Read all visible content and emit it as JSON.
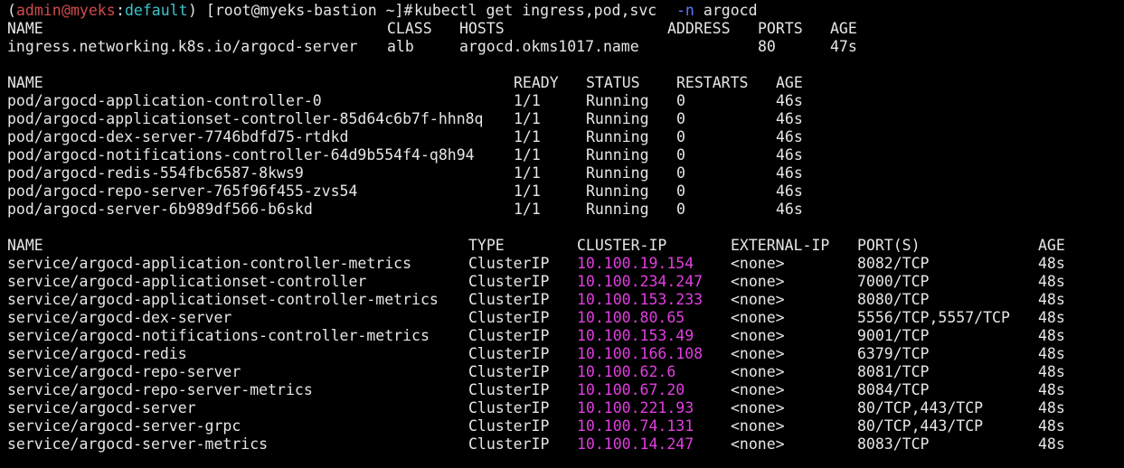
{
  "prompt": {
    "open_paren": "(",
    "user": "admin",
    "at": "@",
    "cluster": "myeks",
    "colon": ":",
    "namespace": "default",
    "close_paren": ")",
    "shell": " [root@myeks-bastion ~]# ",
    "command": "kubectl get ingress,pod,svc ",
    "flag": "-n",
    "arg": " argocd"
  },
  "ingress": {
    "headers": [
      "NAME",
      "CLASS",
      "HOSTS",
      "ADDRESS",
      "PORTS",
      "AGE"
    ],
    "rows": [
      [
        "ingress.networking.k8s.io/argocd-server",
        "alb",
        "argocd.okms1017.name",
        "",
        "80",
        "47s"
      ]
    ]
  },
  "pods": {
    "headers": [
      "NAME",
      "READY",
      "STATUS",
      "RESTARTS",
      "AGE"
    ],
    "rows": [
      [
        "pod/argocd-application-controller-0",
        "1/1",
        "Running",
        "0",
        "46s"
      ],
      [
        "pod/argocd-applicationset-controller-85d64c6b7f-hhn8q",
        "1/1",
        "Running",
        "0",
        "46s"
      ],
      [
        "pod/argocd-dex-server-7746bdfd75-rtdkd",
        "1/1",
        "Running",
        "0",
        "46s"
      ],
      [
        "pod/argocd-notifications-controller-64d9b554f4-q8h94",
        "1/1",
        "Running",
        "0",
        "46s"
      ],
      [
        "pod/argocd-redis-554fbc6587-8kws9",
        "1/1",
        "Running",
        "0",
        "46s"
      ],
      [
        "pod/argocd-repo-server-765f96f455-zvs54",
        "1/1",
        "Running",
        "0",
        "46s"
      ],
      [
        "pod/argocd-server-6b989df566-b6skd",
        "1/1",
        "Running",
        "0",
        "46s"
      ]
    ]
  },
  "services": {
    "headers": [
      "NAME",
      "TYPE",
      "CLUSTER-IP",
      "EXTERNAL-IP",
      "PORT(S)",
      "AGE"
    ],
    "rows": [
      [
        "service/argocd-application-controller-metrics",
        "ClusterIP",
        "10.100.19.154",
        "<none>",
        "8082/TCP",
        "48s"
      ],
      [
        "service/argocd-applicationset-controller",
        "ClusterIP",
        "10.100.234.247",
        "<none>",
        "7000/TCP",
        "48s"
      ],
      [
        "service/argocd-applicationset-controller-metrics",
        "ClusterIP",
        "10.100.153.233",
        "<none>",
        "8080/TCP",
        "48s"
      ],
      [
        "service/argocd-dex-server",
        "ClusterIP",
        "10.100.80.65",
        "<none>",
        "5556/TCP,5557/TCP",
        "48s"
      ],
      [
        "service/argocd-notifications-controller-metrics",
        "ClusterIP",
        "10.100.153.49",
        "<none>",
        "9001/TCP",
        "48s"
      ],
      [
        "service/argocd-redis",
        "ClusterIP",
        "10.100.166.108",
        "<none>",
        "6379/TCP",
        "48s"
      ],
      [
        "service/argocd-repo-server",
        "ClusterIP",
        "10.100.62.6",
        "<none>",
        "8081/TCP",
        "48s"
      ],
      [
        "service/argocd-repo-server-metrics",
        "ClusterIP",
        "10.100.67.20",
        "<none>",
        "8084/TCP",
        "48s"
      ],
      [
        "service/argocd-server",
        "ClusterIP",
        "10.100.221.93",
        "<none>",
        "80/TCP,443/TCP",
        "48s"
      ],
      [
        "service/argocd-server-grpc",
        "ClusterIP",
        "10.100.74.131",
        "<none>",
        "80/TCP,443/TCP",
        "48s"
      ],
      [
        "service/argocd-server-metrics",
        "ClusterIP",
        "10.100.14.247",
        "<none>",
        "8083/TCP",
        "48s"
      ]
    ]
  },
  "colors": {
    "background": "#000000",
    "foreground": "#e6e6e6",
    "prompt_user": "#d24a4a",
    "prompt_context": "#3fc3c9",
    "flag": "#5a78ff",
    "cluster_ip": "#e23ee0"
  }
}
